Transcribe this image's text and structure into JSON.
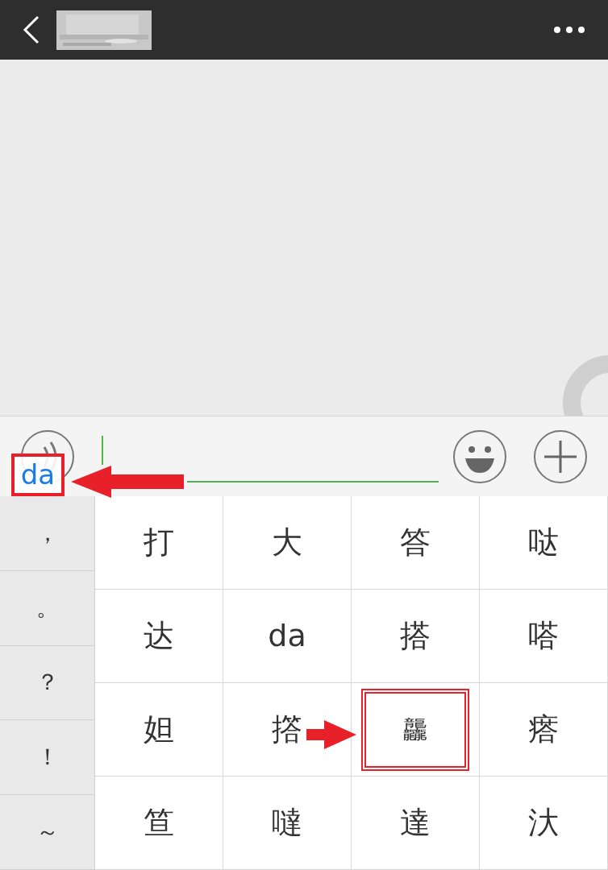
{
  "composer": {
    "composition": "da",
    "composition_marked": true
  },
  "punctuation": [
    "，",
    "。",
    "？",
    "！",
    "～"
  ],
  "candidates": [
    {
      "text": "打",
      "marked": false
    },
    {
      "text": "大",
      "marked": false
    },
    {
      "text": "答",
      "marked": false
    },
    {
      "text": "哒",
      "marked": false
    },
    {
      "text": "达",
      "marked": false
    },
    {
      "text": "da",
      "marked": false
    },
    {
      "text": "搭",
      "marked": false
    },
    {
      "text": "嗒",
      "marked": false
    },
    {
      "text": "妲",
      "marked": false
    },
    {
      "text": "撘",
      "marked": false
    },
    {
      "text": "龘",
      "marked": true
    },
    {
      "text": "瘩",
      "marked": false
    },
    {
      "text": "笪",
      "marked": false
    },
    {
      "text": "噠",
      "marked": false
    },
    {
      "text": "達",
      "marked": false
    },
    {
      "text": "汏",
      "marked": false
    }
  ]
}
